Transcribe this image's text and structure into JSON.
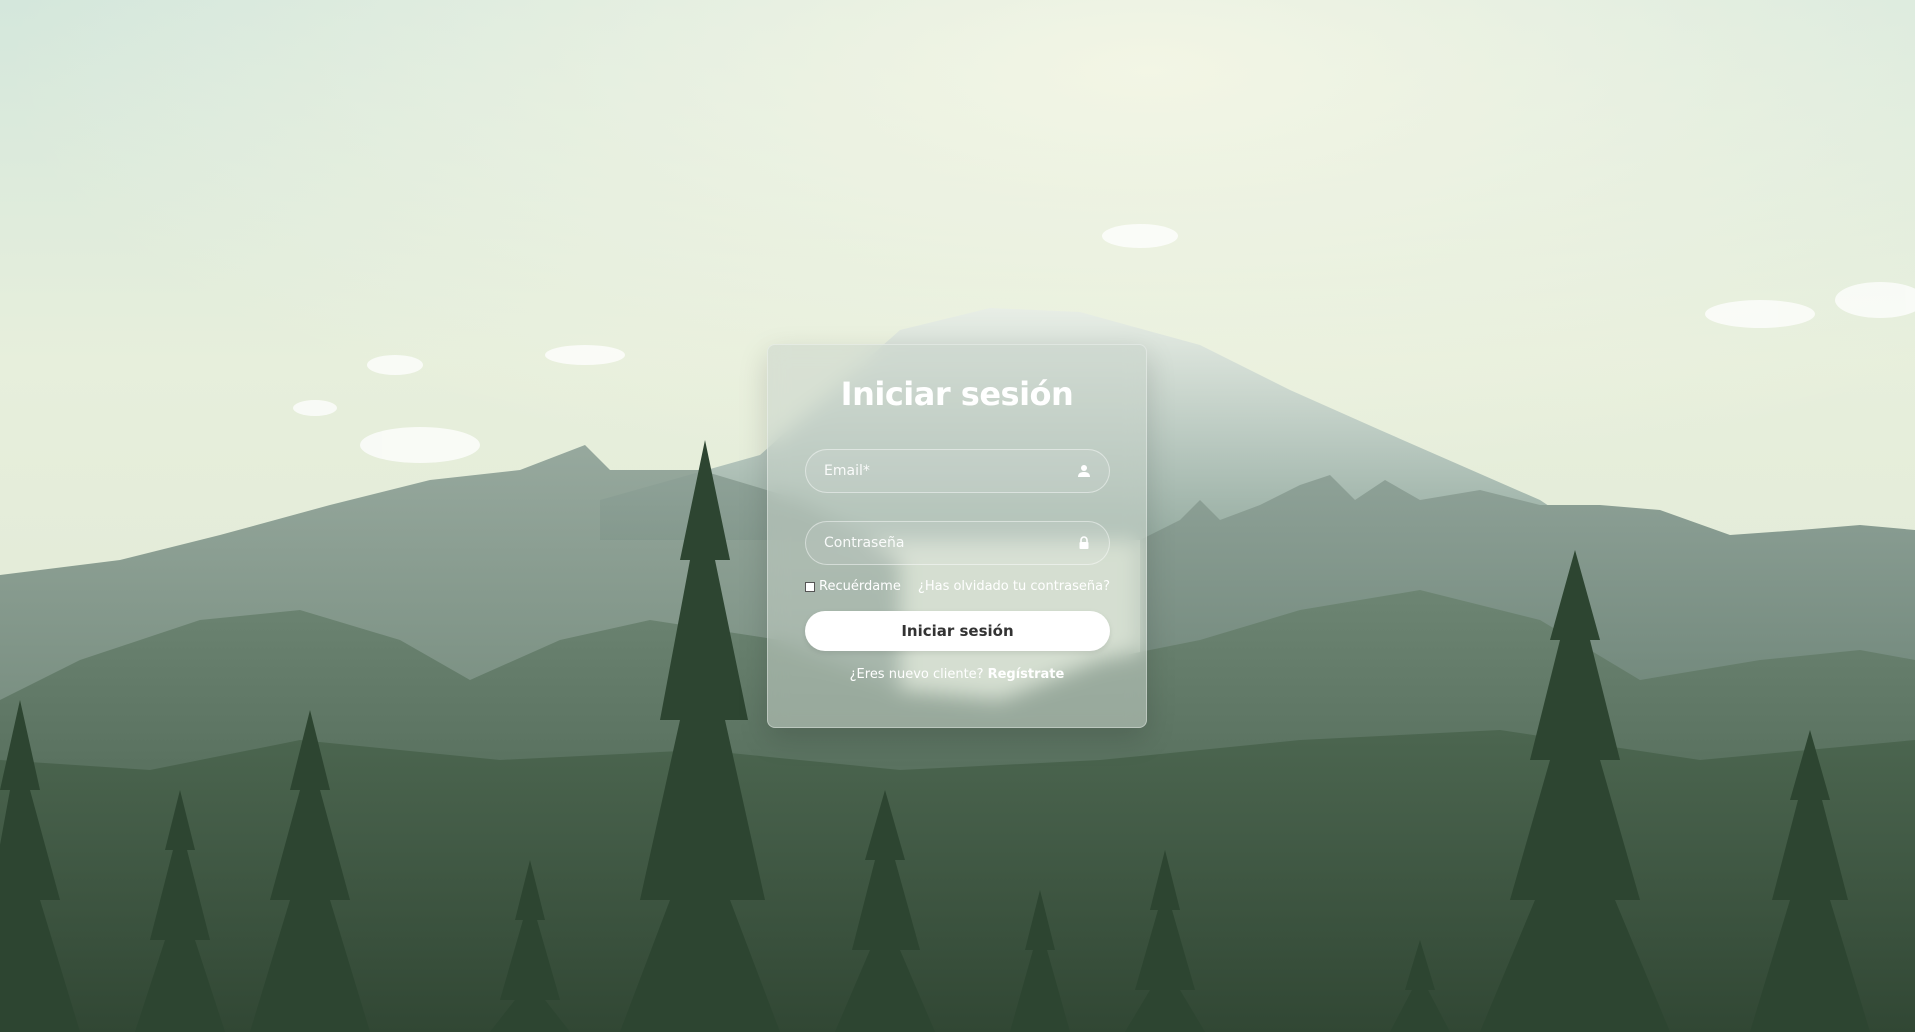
{
  "login": {
    "title": "Iniciar sesión",
    "email_placeholder": "Email*",
    "password_placeholder": "Contraseña",
    "remember_label": "Recuérdame",
    "forgot_link": "¿Has olvidado tu contraseña?",
    "submit_label": "Iniciar sesión",
    "register_prompt": "¿Eres nuevo cliente?",
    "register_link": "Regístrate"
  },
  "icons": {
    "email": "user-icon",
    "password": "lock-icon"
  },
  "colors": {
    "button_background": "#ffffff",
    "button_text": "#333333",
    "card_text": "#ffffff"
  }
}
